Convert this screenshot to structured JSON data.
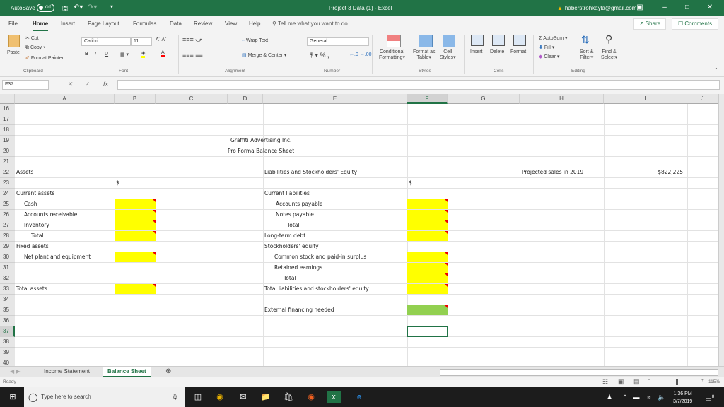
{
  "titlebar": {
    "autosave_label": "AutoSave",
    "autosave_state": "Off",
    "title": "Project 3 Data (1)  -  Excel",
    "account": "haberstrohkayla@gmail.com"
  },
  "menu": {
    "tabs": [
      "File",
      "Home",
      "Insert",
      "Page Layout",
      "Formulas",
      "Data",
      "Review",
      "View",
      "Help"
    ],
    "active_tab": "Home",
    "tell_me": "Tell me what you want to do",
    "share": "Share",
    "comments": "Comments"
  },
  "ribbon": {
    "clipboard": {
      "paste": "Paste",
      "cut": "Cut",
      "copy": "Copy",
      "format_painter": "Format Painter",
      "label": "Clipboard"
    },
    "font": {
      "name": "Calibri",
      "size": "11",
      "bold": "B",
      "italic": "I",
      "underline": "U",
      "label": "Font",
      "fill_color": "#ffff00",
      "font_color": "#ff0000"
    },
    "alignment": {
      "wrap_text": "Wrap Text",
      "merge_center": "Merge & Center",
      "label": "Alignment"
    },
    "number": {
      "format": "General",
      "currency": "$",
      "percent": "%",
      "comma": ",",
      "label": "Number"
    },
    "styles": {
      "conditional": "Conditional",
      "conditional2": "Formatting",
      "format_table": "Format as",
      "format_table2": "Table",
      "cell_styles": "Cell",
      "cell_styles2": "Styles",
      "label": "Styles"
    },
    "cells": {
      "insert": "Insert",
      "delete": "Delete",
      "format": "Format",
      "label": "Cells"
    },
    "editing": {
      "autosum": "AutoSum",
      "fill": "Fill",
      "clear": "Clear",
      "sort": "Sort &",
      "sort2": "Filter",
      "find": "Find &",
      "find2": "Select",
      "label": "Editing"
    }
  },
  "formula_bar": {
    "name_box": "F37",
    "formula": ""
  },
  "columns": [
    "A",
    "B",
    "C",
    "D",
    "E",
    "F",
    "G",
    "H",
    "I",
    "J"
  ],
  "selected_column": "F",
  "rows": [
    "16",
    "17",
    "18",
    "19",
    "20",
    "21",
    "22",
    "23",
    "24",
    "25",
    "26",
    "27",
    "28",
    "29",
    "30",
    "31",
    "32",
    "33",
    "34",
    "35",
    "36",
    "37",
    "38",
    "39",
    "40"
  ],
  "selected_row": "37",
  "cells": {
    "title1": "Graffiti Advertising Inc.",
    "title2": "Pro Forma Balance Sheet",
    "assets": "Assets",
    "dollar_b": "$",
    "current_assets": "Current assets",
    "cash": "Cash",
    "ar": "Accounts receivable",
    "inventory": "Inventory",
    "total_ca": "Total",
    "fixed_assets": "Fixed assets",
    "net_plant": "Net plant and equipment",
    "total_assets": "Total assets",
    "liab_equity": "Liabilities and Stockholders' Equity",
    "dollar_f": "$",
    "current_liab": "Current liabilities",
    "ap": "Accounts payable",
    "np": "Notes payable",
    "total_cl": "Total",
    "ltd": "Long-term debt",
    "se": "Stockholders' equity",
    "common": "Common stock and paid-in surplus",
    "re": "Retained earnings",
    "total_se": "Total",
    "total_le": "Total liabilities and stockholders' equity",
    "efn": "External financing needed",
    "proj_sales_label": "Projected sales in 2019",
    "proj_sales_value": "$822,225"
  },
  "highlight_colors": {
    "input": "#ffff00",
    "result": "#92d050",
    "comment_marker": "#e00000"
  },
  "sheets": {
    "tabs": [
      "Income Statement",
      "Balance Sheet"
    ],
    "active": "Balance Sheet"
  },
  "status": {
    "ready": "Ready",
    "zoom": "115%",
    "zoom_level_percent": 115
  },
  "taskbar": {
    "search_placeholder": "Type here to search",
    "time": "1:36 PM",
    "date": "3/7/2019",
    "notifications": "8"
  }
}
